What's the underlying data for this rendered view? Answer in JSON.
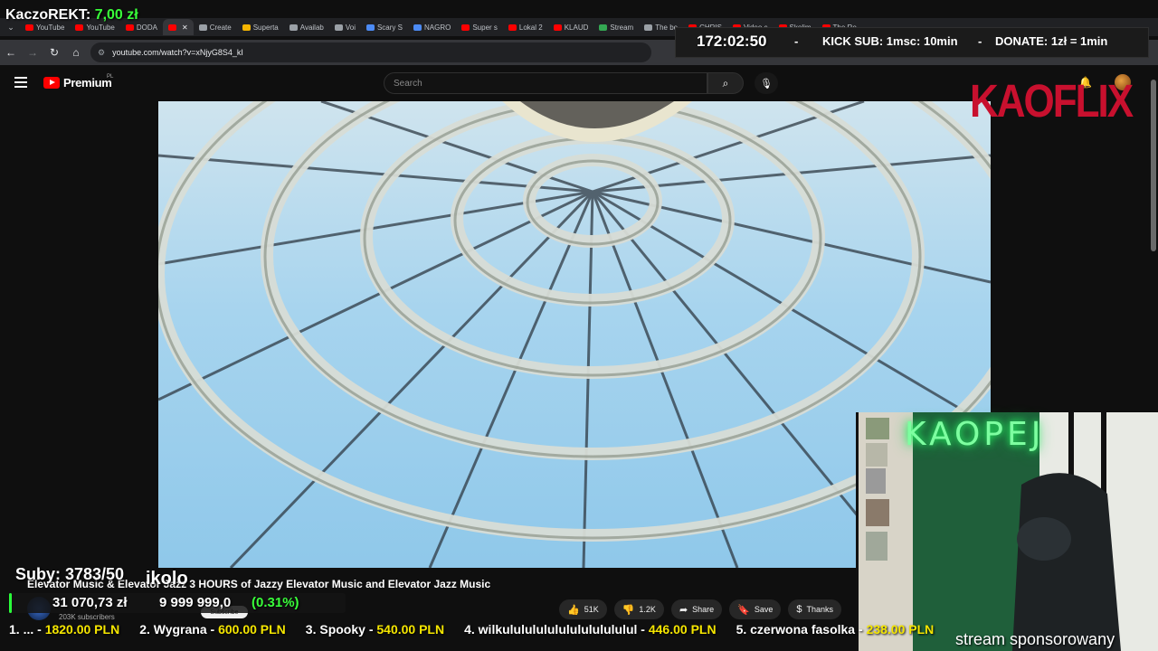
{
  "overlay": {
    "streamer": "KaczoREKT:",
    "last_donation": "7,00 zł",
    "timer": "172:02:50",
    "separator": "-",
    "kick_sub": "KICK SUB: 1msc: 10min",
    "donate_rate": "DONATE: 1zł = 1min",
    "brand": "KAOFLIX",
    "neon_sign": "KAOPEJ",
    "subs_goal": "Suby: 3783/50",
    "okolo": "ikolo",
    "goal_current": "31 070,73 zł",
    "goal_target": "9 999 999,0",
    "goal_percent": "(0.31%)",
    "goal_fraction": 0.0031,
    "sponsored": "stream sponsorowany",
    "leaderboard": [
      {
        "rank": "1. ... -",
        "amount": "1820.00 PLN"
      },
      {
        "rank": "2. Wygrana -",
        "amount": "600.00 PLN"
      },
      {
        "rank": "3. Spooky -",
        "amount": "540.00 PLN"
      },
      {
        "rank": "4. wilkulululululululululululul -",
        "amount": "446.00 PLN"
      },
      {
        "rank": "5. czerwona fasolka -",
        "amount": "238.00 PLN"
      }
    ]
  },
  "browser": {
    "tabs": [
      {
        "label": "YouTube",
        "fav": "youtube-icon"
      },
      {
        "label": "YouTube",
        "fav": "youtube-icon"
      },
      {
        "label": "DODA",
        "fav": "youtube-icon"
      },
      {
        "label": "",
        "fav": "youtube-icon",
        "active": true
      },
      {
        "label": "Create",
        "fav": "doc-icon"
      },
      {
        "label": "Superta",
        "fav": "superta-icon"
      },
      {
        "label": "Availab",
        "fav": "globe-icon"
      },
      {
        "label": "Voi",
        "fav": "globe-icon"
      },
      {
        "label": "Scary S",
        "fav": "app-icon"
      },
      {
        "label": "NAGRO",
        "fav": "app-icon"
      },
      {
        "label": "Super s",
        "fav": "youtube-icon"
      },
      {
        "label": "Lokal 2",
        "fav": "youtube-icon"
      },
      {
        "label": "KLAUD",
        "fav": "youtube-icon"
      },
      {
        "label": "Stream",
        "fav": "kick-icon"
      },
      {
        "label": "The be",
        "fav": "globe-icon"
      },
      {
        "label": "CHRIS",
        "fav": "youtube-icon"
      },
      {
        "label": "Video c",
        "fav": "youtube-icon"
      },
      {
        "label": "Skolim",
        "fav": "youtube-icon"
      },
      {
        "label": "The Ro",
        "fav": "youtube-icon"
      }
    ],
    "url": "youtube.com/watch?v=xNjyG8S4_kI"
  },
  "youtube": {
    "logo_text": "Premium",
    "region": "PL",
    "search_placeholder": "Search",
    "video_title": "Elevator Music & Elevator Jazz 3 HOURS of Jazzy Elevator Music and Elevator Jazz Music",
    "subscribers": "203K subscribers",
    "subscribe_label": "Subscribe",
    "likes": "51K",
    "dislikes": "1.2K",
    "share": "Share",
    "save": "Save",
    "thanks": "Thanks"
  },
  "colors": {
    "youtube_red": "#ff0000",
    "goal_green": "#2aff3a",
    "ticker_amount": "#f5e600",
    "kaoflix_red": "#c8102e",
    "neon_green": "#7dffa0"
  }
}
